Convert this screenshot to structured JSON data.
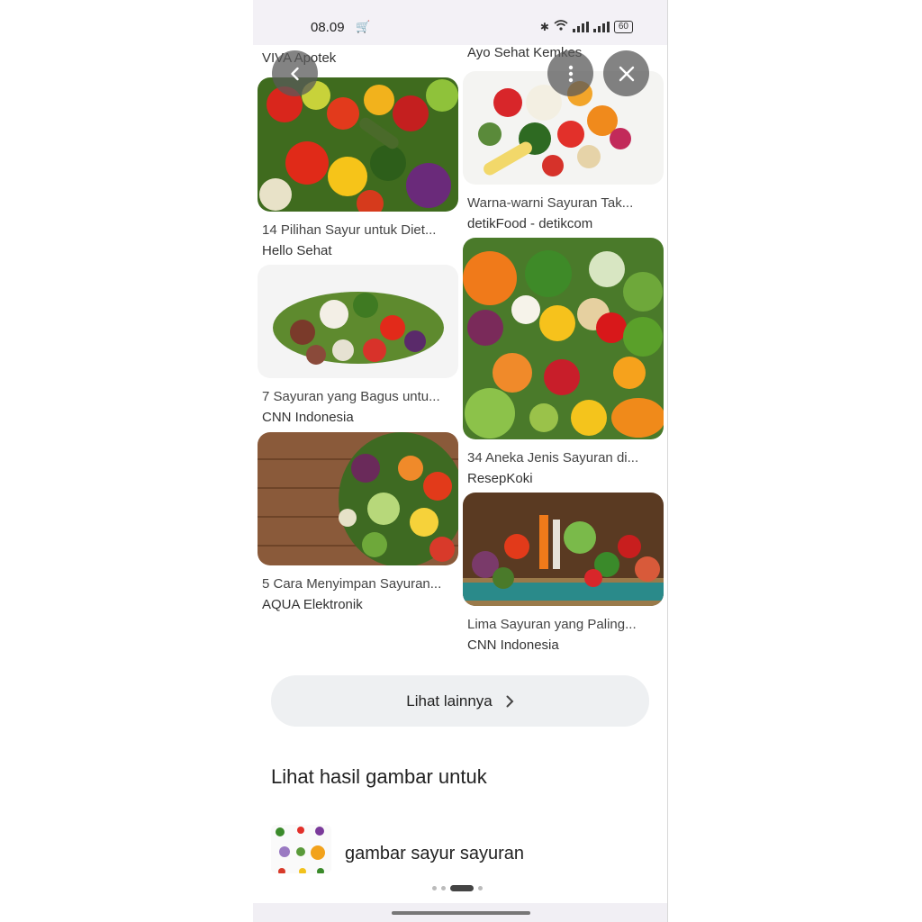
{
  "status_bar": {
    "time": "08.09",
    "battery": "60"
  },
  "top_row": {
    "left_source": "VIVA Apotek",
    "right_source": "Ayo Sehat Kemkes"
  },
  "results": [
    {
      "title": "14 Pilihan Sayur untuk Diet...",
      "source": "Hello Sehat"
    },
    {
      "title": "Warna-warni Sayuran Tak...",
      "source": "detikFood - detikcom"
    },
    {
      "title": "7 Sayuran yang Bagus untu...",
      "source": "CNN Indonesia"
    },
    {
      "title": "34 Aneka Jenis Sayuran di...",
      "source": "ResepKoki"
    },
    {
      "title": "5 Cara Menyimpan Sayuran...",
      "source": "AQUA Elektronik"
    },
    {
      "title": "Lima Sayuran yang Paling...",
      "source": "CNN Indonesia"
    }
  ],
  "more_button": {
    "label": "Lihat lainnya"
  },
  "related": {
    "heading": "Lihat hasil gambar untuk",
    "suggestion": "gambar sayur sayuran"
  },
  "carousel": {
    "page_count": 4,
    "active_page": 3
  },
  "colors": {
    "accent_overlay": "#5a5a5a",
    "button_bg": "#eef0f2",
    "status_bg": "#f3f1f6"
  },
  "icons": {
    "back": "chevron-left-icon",
    "menu": "more-vert-icon",
    "close": "close-icon",
    "more": "chevron-right-icon"
  }
}
